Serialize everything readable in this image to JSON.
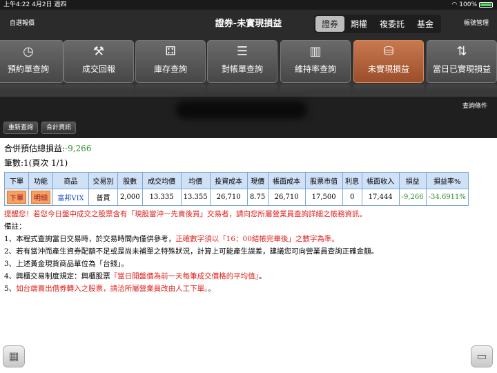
{
  "status_bar": {
    "time": "上午4:22",
    "date": "4月2日 週四",
    "battery": "100%"
  },
  "header": {
    "left_label": "自選報價",
    "title": "證券-未實現損益",
    "segments": [
      "證券",
      "期權",
      "複委託",
      "基金"
    ],
    "active_segment": "證券",
    "right_label": "帳號管理"
  },
  "tabs": [
    {
      "label": "預約單查詢",
      "icon": "clock-search-icon",
      "glyph": "◷"
    },
    {
      "label": "成交回報",
      "icon": "gavel-icon",
      "glyph": "⚒"
    },
    {
      "label": "庫存查詢",
      "icon": "grid-search-icon",
      "glyph": "⚃"
    },
    {
      "label": "對帳單查詢",
      "icon": "statement-icon",
      "glyph": "☰"
    },
    {
      "label": "維持率查詢",
      "icon": "bar-chart-icon",
      "glyph": "▥"
    },
    {
      "label": "未實現損益",
      "icon": "coins-search-icon",
      "glyph": "⛁",
      "active": true
    },
    {
      "label": "當日已實現損益",
      "icon": "transfer-icon",
      "glyph": "⇅"
    }
  ],
  "subheader": {
    "query_conditions": "查詢條件",
    "refresh_button": "重新查詢",
    "summary_button": "合計資訊"
  },
  "summary": {
    "total_label": "合併預估總損益:",
    "total_value": "-9,266",
    "count_text": "筆數:1(頁次 1/1)"
  },
  "table": {
    "headers": [
      "下單",
      "功能",
      "商品",
      "交易別",
      "股數",
      "成交均價",
      "均價",
      "投資成本",
      "現價",
      "帳面成本",
      "股票市值",
      "利息",
      "帳面收入",
      "損益",
      "損益率%"
    ],
    "rows": [
      {
        "order": "下單",
        "function": "明細",
        "product": "富邦VIX",
        "trade_type": "普買",
        "shares": "2,000",
        "avg_fill_price": "13.335",
        "avg_price": "13.355",
        "investment_cost": "26,710",
        "current_price": "8.75",
        "book_cost": "26,710",
        "market_value": "17,500",
        "interest": "0",
        "book_income": "17,444",
        "pnl": "-9,266",
        "pnl_rate": "-34.6911%"
      }
    ]
  },
  "reminder": "提醒您！若您今日盤中成交之股票含有「現股當沖－先賣後買」交易者，請向您所屬營業員查詢詳細之帳務資訊。",
  "notes": {
    "title": "備註：",
    "items": [
      {
        "plain": "1、本程式查詢當日交易時，於交易時間內僅供參考，",
        "red": "正確數字須以「16：00結帳完畢後」之數字為準。",
        "tail": ""
      },
      {
        "plain": "2、若有當沖而產生資券配額不足或是尚未補單之特殊狀況，計算上可能產生誤差，建議您可向營業員查詢正確金額。",
        "red": "",
        "tail": ""
      },
      {
        "plain": "3、上述黃金現貨商品單位為「台錢」。",
        "red": "",
        "tail": ""
      },
      {
        "plain": "4、興櫃交易制度規定：興櫃股票",
        "red": "『當日開盤價為前一天每筆成交價格的平均值』",
        "tail": "。"
      },
      {
        "plain": "5、",
        "red": "如台端賣出借券轉入之股票，請洽所屬營業員改由人工下單。",
        "tail": "。"
      }
    ]
  },
  "colors": {
    "negative": "#2e8b2e",
    "warning": "#e0201b",
    "active_tab": "#b5623a",
    "table_header": "#cfe1f6"
  }
}
